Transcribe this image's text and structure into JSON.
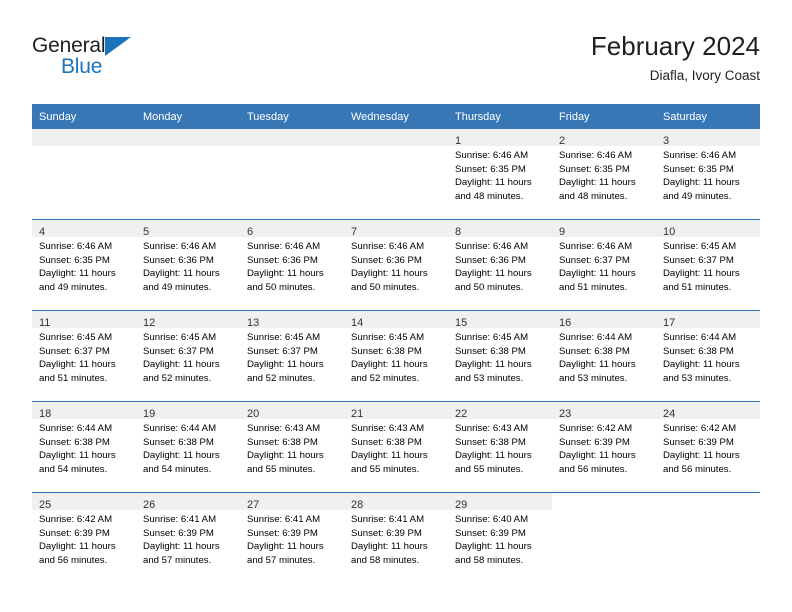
{
  "brand": {
    "name_top": "General",
    "name_bottom": "Blue",
    "accent_color": "#1c75bc",
    "triangle_icon": "brand-triangle-icon"
  },
  "header": {
    "month_title": "February 2024",
    "location": "Diafla, Ivory Coast"
  },
  "colors": {
    "header_row_bg": "#3877b6",
    "week_separator": "#2f6fad",
    "daynum_band_bg": "#f0f0f0",
    "text": "#000000"
  },
  "weekday_headers": [
    "Sunday",
    "Monday",
    "Tuesday",
    "Wednesday",
    "Thursday",
    "Friday",
    "Saturday"
  ],
  "weeks": [
    [
      {
        "day": "",
        "blank": true,
        "lines": []
      },
      {
        "day": "",
        "blank": true,
        "lines": []
      },
      {
        "day": "",
        "blank": true,
        "lines": []
      },
      {
        "day": "",
        "blank": true,
        "lines": []
      },
      {
        "day": "1",
        "lines": [
          "Sunrise: 6:46 AM",
          "Sunset: 6:35 PM",
          "Daylight: 11 hours",
          "and 48 minutes."
        ]
      },
      {
        "day": "2",
        "lines": [
          "Sunrise: 6:46 AM",
          "Sunset: 6:35 PM",
          "Daylight: 11 hours",
          "and 48 minutes."
        ]
      },
      {
        "day": "3",
        "lines": [
          "Sunrise: 6:46 AM",
          "Sunset: 6:35 PM",
          "Daylight: 11 hours",
          "and 49 minutes."
        ]
      }
    ],
    [
      {
        "day": "4",
        "lines": [
          "Sunrise: 6:46 AM",
          "Sunset: 6:35 PM",
          "Daylight: 11 hours",
          "and 49 minutes."
        ]
      },
      {
        "day": "5",
        "lines": [
          "Sunrise: 6:46 AM",
          "Sunset: 6:36 PM",
          "Daylight: 11 hours",
          "and 49 minutes."
        ]
      },
      {
        "day": "6",
        "lines": [
          "Sunrise: 6:46 AM",
          "Sunset: 6:36 PM",
          "Daylight: 11 hours",
          "and 50 minutes."
        ]
      },
      {
        "day": "7",
        "lines": [
          "Sunrise: 6:46 AM",
          "Sunset: 6:36 PM",
          "Daylight: 11 hours",
          "and 50 minutes."
        ]
      },
      {
        "day": "8",
        "lines": [
          "Sunrise: 6:46 AM",
          "Sunset: 6:36 PM",
          "Daylight: 11 hours",
          "and 50 minutes."
        ]
      },
      {
        "day": "9",
        "lines": [
          "Sunrise: 6:46 AM",
          "Sunset: 6:37 PM",
          "Daylight: 11 hours",
          "and 51 minutes."
        ]
      },
      {
        "day": "10",
        "lines": [
          "Sunrise: 6:45 AM",
          "Sunset: 6:37 PM",
          "Daylight: 11 hours",
          "and 51 minutes."
        ]
      }
    ],
    [
      {
        "day": "11",
        "lines": [
          "Sunrise: 6:45 AM",
          "Sunset: 6:37 PM",
          "Daylight: 11 hours",
          "and 51 minutes."
        ]
      },
      {
        "day": "12",
        "lines": [
          "Sunrise: 6:45 AM",
          "Sunset: 6:37 PM",
          "Daylight: 11 hours",
          "and 52 minutes."
        ]
      },
      {
        "day": "13",
        "lines": [
          "Sunrise: 6:45 AM",
          "Sunset: 6:37 PM",
          "Daylight: 11 hours",
          "and 52 minutes."
        ]
      },
      {
        "day": "14",
        "lines": [
          "Sunrise: 6:45 AM",
          "Sunset: 6:38 PM",
          "Daylight: 11 hours",
          "and 52 minutes."
        ]
      },
      {
        "day": "15",
        "lines": [
          "Sunrise: 6:45 AM",
          "Sunset: 6:38 PM",
          "Daylight: 11 hours",
          "and 53 minutes."
        ]
      },
      {
        "day": "16",
        "lines": [
          "Sunrise: 6:44 AM",
          "Sunset: 6:38 PM",
          "Daylight: 11 hours",
          "and 53 minutes."
        ]
      },
      {
        "day": "17",
        "lines": [
          "Sunrise: 6:44 AM",
          "Sunset: 6:38 PM",
          "Daylight: 11 hours",
          "and 53 minutes."
        ]
      }
    ],
    [
      {
        "day": "18",
        "lines": [
          "Sunrise: 6:44 AM",
          "Sunset: 6:38 PM",
          "Daylight: 11 hours",
          "and 54 minutes."
        ]
      },
      {
        "day": "19",
        "lines": [
          "Sunrise: 6:44 AM",
          "Sunset: 6:38 PM",
          "Daylight: 11 hours",
          "and 54 minutes."
        ]
      },
      {
        "day": "20",
        "lines": [
          "Sunrise: 6:43 AM",
          "Sunset: 6:38 PM",
          "Daylight: 11 hours",
          "and 55 minutes."
        ]
      },
      {
        "day": "21",
        "lines": [
          "Sunrise: 6:43 AM",
          "Sunset: 6:38 PM",
          "Daylight: 11 hours",
          "and 55 minutes."
        ]
      },
      {
        "day": "22",
        "lines": [
          "Sunrise: 6:43 AM",
          "Sunset: 6:38 PM",
          "Daylight: 11 hours",
          "and 55 minutes."
        ]
      },
      {
        "day": "23",
        "lines": [
          "Sunrise: 6:42 AM",
          "Sunset: 6:39 PM",
          "Daylight: 11 hours",
          "and 56 minutes."
        ]
      },
      {
        "day": "24",
        "lines": [
          "Sunrise: 6:42 AM",
          "Sunset: 6:39 PM",
          "Daylight: 11 hours",
          "and 56 minutes."
        ]
      }
    ],
    [
      {
        "day": "25",
        "lines": [
          "Sunrise: 6:42 AM",
          "Sunset: 6:39 PM",
          "Daylight: 11 hours",
          "and 56 minutes."
        ]
      },
      {
        "day": "26",
        "lines": [
          "Sunrise: 6:41 AM",
          "Sunset: 6:39 PM",
          "Daylight: 11 hours",
          "and 57 minutes."
        ]
      },
      {
        "day": "27",
        "lines": [
          "Sunrise: 6:41 AM",
          "Sunset: 6:39 PM",
          "Daylight: 11 hours",
          "and 57 minutes."
        ]
      },
      {
        "day": "28",
        "lines": [
          "Sunrise: 6:41 AM",
          "Sunset: 6:39 PM",
          "Daylight: 11 hours",
          "and 58 minutes."
        ]
      },
      {
        "day": "29",
        "lines": [
          "Sunrise: 6:40 AM",
          "Sunset: 6:39 PM",
          "Daylight: 11 hours",
          "and 58 minutes."
        ]
      },
      {
        "day": "",
        "blank": true,
        "lines": []
      },
      {
        "day": "",
        "blank": true,
        "lines": []
      }
    ]
  ]
}
